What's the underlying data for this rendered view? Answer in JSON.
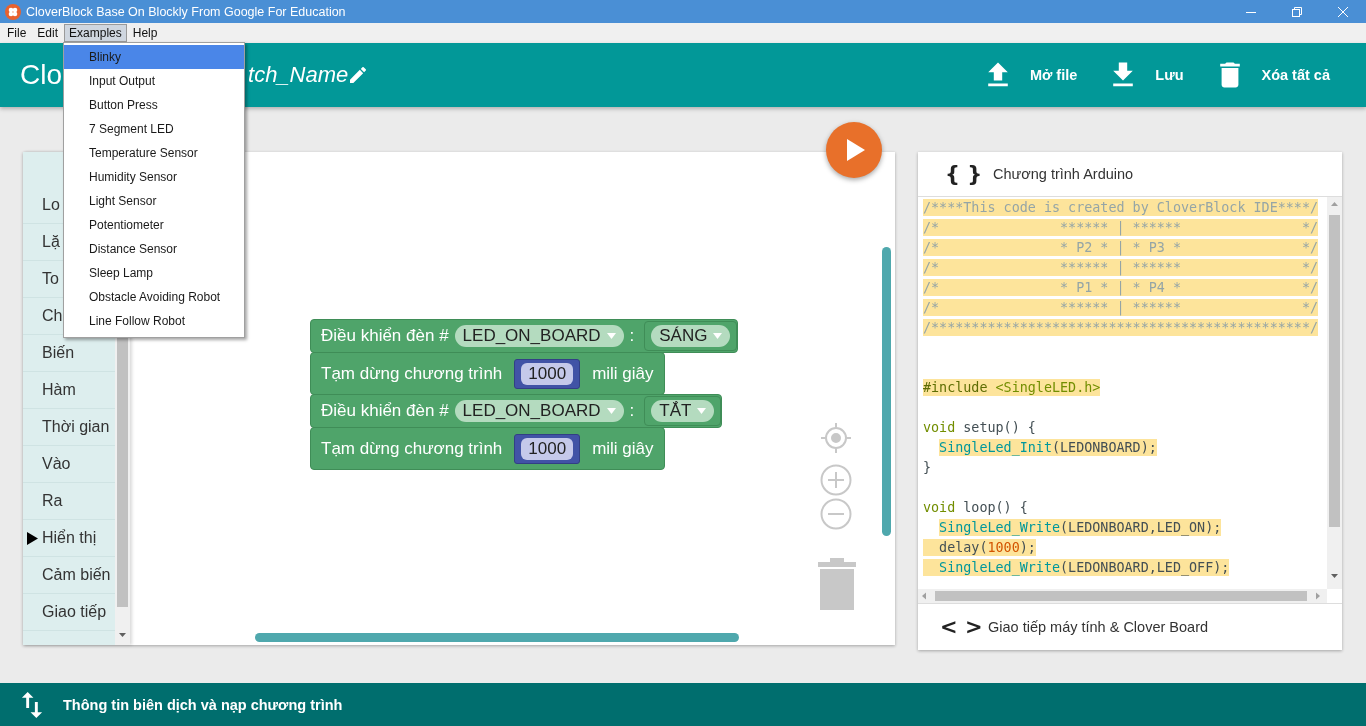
{
  "window": {
    "title": "CloverBlock Base On Blockly From Google For Education"
  },
  "menu_bar": [
    {
      "label": "File",
      "selected": false
    },
    {
      "label": "Edit",
      "selected": false
    },
    {
      "label": "Examples",
      "selected": true
    },
    {
      "label": "Help",
      "selected": false
    }
  ],
  "examples_menu": [
    {
      "label": "Blinky",
      "selected": true
    },
    {
      "label": "Input Output",
      "selected": false
    },
    {
      "label": "Button Press",
      "selected": false
    },
    {
      "label": "7 Segment LED",
      "selected": false
    },
    {
      "label": "Temperature Sensor",
      "selected": false
    },
    {
      "label": "Humidity Sensor",
      "selected": false
    },
    {
      "label": "Light Sensor",
      "selected": false
    },
    {
      "label": "Potentiometer",
      "selected": false
    },
    {
      "label": "Distance Sensor",
      "selected": false
    },
    {
      "label": "Sleep Lamp",
      "selected": false
    },
    {
      "label": "Obstacle Avoiding Robot",
      "selected": false
    },
    {
      "label": "Line Follow Robot",
      "selected": false
    }
  ],
  "header": {
    "title": "Clo",
    "sketch_name": "tch_Name",
    "actions": [
      {
        "kind": "upload",
        "label": "Mở file"
      },
      {
        "kind": "download",
        "label": "Lưu"
      },
      {
        "kind": "trash",
        "label": "Xóa tất cả"
      }
    ]
  },
  "toolbox": [
    {
      "label": "Lo",
      "selected": false
    },
    {
      "label": "Lặ",
      "selected": false
    },
    {
      "label": "To",
      "selected": false
    },
    {
      "label": "Ch",
      "selected": false
    },
    {
      "label": "Biến",
      "selected": false
    },
    {
      "label": "Hàm",
      "selected": false
    },
    {
      "label": "Thời gian",
      "selected": false
    },
    {
      "label": "Vào",
      "selected": false
    },
    {
      "label": "Ra",
      "selected": false
    },
    {
      "label": "Hiển thị",
      "selected": true
    },
    {
      "label": "Cảm biến",
      "selected": false
    },
    {
      "label": "Giao tiếp",
      "selected": false
    }
  ],
  "workspace": {
    "blocks": [
      {
        "kind": "led",
        "label": "Điều khiển đèn #",
        "pin": "LED_ON_BOARD",
        "separator": ":",
        "state": "SÁNG"
      },
      {
        "kind": "delay",
        "label": "Tạm dừng chương trình",
        "value": "1000",
        "unit": "mili giây"
      },
      {
        "kind": "led",
        "label": "Điều khiển đèn #",
        "pin": "LED_ON_BOARD",
        "separator": ":",
        "state": "TẮT"
      },
      {
        "kind": "delay",
        "label": "Tạm dừng chương trình",
        "value": "1000",
        "unit": "mili giây"
      }
    ]
  },
  "code_panel": {
    "title_icon": "{ }",
    "title": "Chương trình Arduino",
    "lines": [
      {
        "kind": "code",
        "highlighted": true,
        "segments": [
          {
            "kind": "comment",
            "text": "/****This code is created by CloverBlock IDE****/"
          }
        ]
      },
      {
        "kind": "code",
        "highlighted": true,
        "segments": [
          {
            "kind": "comment",
            "text": "/*               ****** | ******               */"
          }
        ]
      },
      {
        "kind": "code",
        "highlighted": true,
        "segments": [
          {
            "kind": "comment",
            "text": "/*               * P2 * | * P3 *               */"
          }
        ]
      },
      {
        "kind": "code",
        "highlighted": true,
        "segments": [
          {
            "kind": "comment",
            "text": "/*               ****** | ******               */"
          }
        ]
      },
      {
        "kind": "code",
        "highlighted": true,
        "segments": [
          {
            "kind": "comment",
            "text": "/*               * P1 * | * P4 *               */"
          }
        ]
      },
      {
        "kind": "code",
        "highlighted": true,
        "segments": [
          {
            "kind": "comment",
            "text": "/*               ****** | ******               */"
          }
        ]
      },
      {
        "kind": "code",
        "highlighted": true,
        "segments": [
          {
            "kind": "comment",
            "text": "/***********************************************/"
          }
        ]
      },
      {
        "kind": "blank"
      },
      {
        "kind": "blank"
      },
      {
        "kind": "code",
        "highlighted": true,
        "segments": [
          {
            "kind": "preprocessor",
            "text": "#include "
          },
          {
            "kind": "header",
            "text": "<SingleLED.h>"
          }
        ]
      },
      {
        "kind": "blank"
      },
      {
        "kind": "code",
        "highlighted": false,
        "segments": [
          {
            "kind": "keyword",
            "text": "void"
          },
          {
            "kind": "plain",
            "text": " setup() {"
          }
        ]
      },
      {
        "kind": "indented",
        "highlighted": true,
        "segments": [
          {
            "kind": "function",
            "text": "SingleLed_Init"
          },
          {
            "kind": "plain",
            "text": "(LEDONBOARD);"
          }
        ]
      },
      {
        "kind": "code",
        "highlighted": false,
        "segments": [
          {
            "kind": "plain",
            "text": "}"
          }
        ]
      },
      {
        "kind": "blank"
      },
      {
        "kind": "code",
        "highlighted": false,
        "segments": [
          {
            "kind": "keyword",
            "text": "void"
          },
          {
            "kind": "plain",
            "text": " loop() {"
          }
        ]
      },
      {
        "kind": "indented",
        "highlighted": true,
        "segments": [
          {
            "kind": "function",
            "text": "SingleLed_Write"
          },
          {
            "kind": "plain",
            "text": "(LEDONBOARD,LED_ON);"
          }
        ]
      },
      {
        "kind": "lead",
        "highlighted": true,
        "segments": [
          {
            "kind": "plain",
            "text": "delay("
          },
          {
            "kind": "number",
            "text": "1000"
          },
          {
            "kind": "plain",
            "text": ");"
          }
        ]
      },
      {
        "kind": "lead",
        "highlighted": true,
        "segments": [
          {
            "kind": "function",
            "text": "SingleLed_Write"
          },
          {
            "kind": "plain",
            "text": "(LEDONBOARD,LED_OFF);"
          }
        ]
      }
    ],
    "footer_icon": "< >",
    "footer": "Giao tiếp máy tính & Clover Board"
  },
  "status_bar": {
    "label": "Thông tin biên dịch và nạp chương trình"
  }
}
